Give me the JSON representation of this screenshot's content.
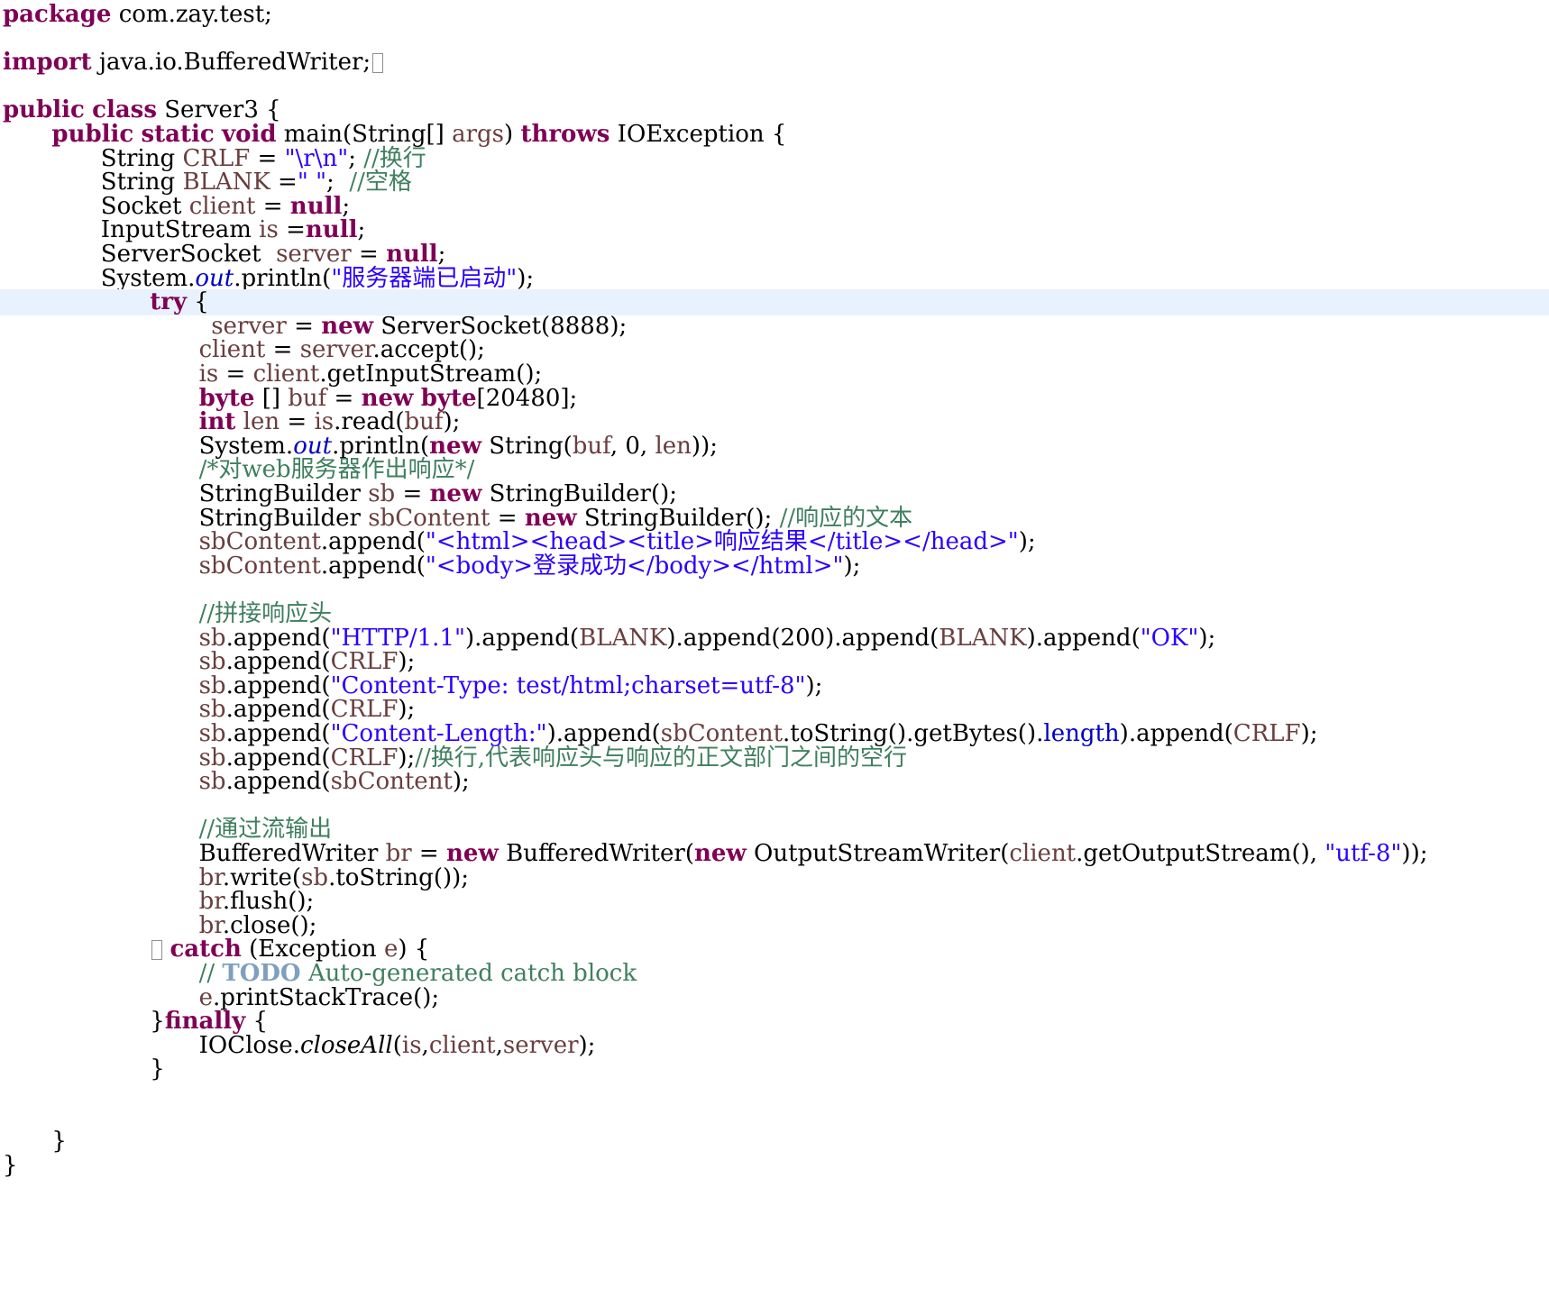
{
  "editor": {
    "current_line_index": 12,
    "lines": [
      {
        "indent": 0,
        "tokens": [
          {
            "t": "kw",
            "v": "package"
          },
          {
            "t": "plain",
            "v": " com.zay.test;"
          }
        ]
      },
      {
        "indent": 0,
        "tokens": []
      },
      {
        "indent": 0,
        "tokens": [
          {
            "t": "kw",
            "v": "import"
          },
          {
            "t": "plain",
            "v": " java.io.BufferedWriter;"
          },
          {
            "t": "fold",
            "v": ""
          }
        ]
      },
      {
        "indent": 0,
        "tokens": []
      },
      {
        "indent": 0,
        "tokens": [
          {
            "t": "kw",
            "v": "public"
          },
          {
            "t": "plain",
            "v": " "
          },
          {
            "t": "kw",
            "v": "class"
          },
          {
            "t": "plain",
            "v": " Server3 {"
          }
        ]
      },
      {
        "indent": 4,
        "tokens": [
          {
            "t": "kw",
            "v": "public"
          },
          {
            "t": "plain",
            "v": " "
          },
          {
            "t": "kw",
            "v": "static"
          },
          {
            "t": "plain",
            "v": " "
          },
          {
            "t": "kw",
            "v": "void"
          },
          {
            "t": "plain",
            "v": " main(String[] "
          },
          {
            "t": "var",
            "v": "args"
          },
          {
            "t": "plain",
            "v": ") "
          },
          {
            "t": "kw",
            "v": "throws"
          },
          {
            "t": "plain",
            "v": " IOException {"
          }
        ]
      },
      {
        "indent": 8,
        "tokens": [
          {
            "t": "plain",
            "v": "String "
          },
          {
            "t": "var",
            "v": "CRLF"
          },
          {
            "t": "plain",
            "v": " = "
          },
          {
            "t": "str",
            "v": "\"\\r\\n\""
          },
          {
            "t": "plain",
            "v": "; "
          },
          {
            "t": "com",
            "v": "//换行"
          }
        ]
      },
      {
        "indent": 8,
        "tokens": [
          {
            "t": "plain",
            "v": "String "
          },
          {
            "t": "var",
            "v": "BLANK"
          },
          {
            "t": "plain",
            "v": " ="
          },
          {
            "t": "str",
            "v": "\" \""
          },
          {
            "t": "plain",
            "v": ";  "
          },
          {
            "t": "com",
            "v": "//空格"
          }
        ]
      },
      {
        "indent": 8,
        "tokens": [
          {
            "t": "plain",
            "v": "Socket "
          },
          {
            "t": "var",
            "v": "client"
          },
          {
            "t": "plain",
            "v": " = "
          },
          {
            "t": "kw",
            "v": "null"
          },
          {
            "t": "plain",
            "v": ";"
          }
        ]
      },
      {
        "indent": 8,
        "tokens": [
          {
            "t": "plain",
            "v": "InputStream "
          },
          {
            "t": "var",
            "v": "is"
          },
          {
            "t": "plain",
            "v": " ="
          },
          {
            "t": "kw",
            "v": "null"
          },
          {
            "t": "plain",
            "v": ";"
          }
        ]
      },
      {
        "indent": 8,
        "tokens": [
          {
            "t": "plain",
            "v": "ServerSocket  "
          },
          {
            "t": "var",
            "v": "server"
          },
          {
            "t": "plain",
            "v": " = "
          },
          {
            "t": "kw",
            "v": "null"
          },
          {
            "t": "plain",
            "v": ";"
          }
        ]
      },
      {
        "indent": 8,
        "tokens": [
          {
            "t": "plain",
            "v": "System."
          },
          {
            "t": "sfield",
            "v": "out"
          },
          {
            "t": "plain",
            "v": ".println("
          },
          {
            "t": "str",
            "v": "\"服务器端已启动\""
          },
          {
            "t": "plain",
            "v": ");"
          }
        ]
      },
      {
        "indent": 12,
        "tokens": [
          {
            "t": "kw",
            "v": "try"
          },
          {
            "t": "plain",
            "v": " {"
          }
        ]
      },
      {
        "indent": 17,
        "tokens": [
          {
            "t": "var",
            "v": "server"
          },
          {
            "t": "plain",
            "v": " = "
          },
          {
            "t": "kw",
            "v": "new"
          },
          {
            "t": "plain",
            "v": " ServerSocket(8888);"
          }
        ]
      },
      {
        "indent": 16,
        "tokens": [
          {
            "t": "var",
            "v": "client"
          },
          {
            "t": "plain",
            "v": " = "
          },
          {
            "t": "var",
            "v": "server"
          },
          {
            "t": "plain",
            "v": ".accept();"
          }
        ]
      },
      {
        "indent": 16,
        "tokens": [
          {
            "t": "var",
            "v": "is"
          },
          {
            "t": "plain",
            "v": " = "
          },
          {
            "t": "var",
            "v": "client"
          },
          {
            "t": "plain",
            "v": ".getInputStream();"
          }
        ]
      },
      {
        "indent": 16,
        "tokens": [
          {
            "t": "kw",
            "v": "byte"
          },
          {
            "t": "plain",
            "v": " [] "
          },
          {
            "t": "var",
            "v": "buf"
          },
          {
            "t": "plain",
            "v": " = "
          },
          {
            "t": "kw",
            "v": "new"
          },
          {
            "t": "plain",
            "v": " "
          },
          {
            "t": "kw",
            "v": "byte"
          },
          {
            "t": "plain",
            "v": "[20480];"
          }
        ]
      },
      {
        "indent": 16,
        "tokens": [
          {
            "t": "kw",
            "v": "int"
          },
          {
            "t": "plain",
            "v": " "
          },
          {
            "t": "var",
            "v": "len"
          },
          {
            "t": "plain",
            "v": " = "
          },
          {
            "t": "var",
            "v": "is"
          },
          {
            "t": "plain",
            "v": ".read("
          },
          {
            "t": "var",
            "v": "buf"
          },
          {
            "t": "plain",
            "v": ");"
          }
        ]
      },
      {
        "indent": 16,
        "tokens": [
          {
            "t": "plain",
            "v": "System."
          },
          {
            "t": "sfield",
            "v": "out"
          },
          {
            "t": "plain",
            "v": ".println("
          },
          {
            "t": "kw",
            "v": "new"
          },
          {
            "t": "plain",
            "v": " String("
          },
          {
            "t": "var",
            "v": "buf"
          },
          {
            "t": "plain",
            "v": ", 0, "
          },
          {
            "t": "var",
            "v": "len"
          },
          {
            "t": "plain",
            "v": "));"
          }
        ]
      },
      {
        "indent": 16,
        "tokens": [
          {
            "t": "com",
            "v": "/*对web服务器作出响应*/"
          }
        ]
      },
      {
        "indent": 16,
        "tokens": [
          {
            "t": "plain",
            "v": "StringBuilder "
          },
          {
            "t": "var",
            "v": "sb"
          },
          {
            "t": "plain",
            "v": " = "
          },
          {
            "t": "kw",
            "v": "new"
          },
          {
            "t": "plain",
            "v": " StringBuilder();"
          }
        ]
      },
      {
        "indent": 16,
        "tokens": [
          {
            "t": "plain",
            "v": "StringBuilder "
          },
          {
            "t": "var",
            "v": "sbContent"
          },
          {
            "t": "plain",
            "v": " = "
          },
          {
            "t": "kw",
            "v": "new"
          },
          {
            "t": "plain",
            "v": " StringBuilder(); "
          },
          {
            "t": "com",
            "v": "//响应的文本"
          }
        ]
      },
      {
        "indent": 16,
        "tokens": [
          {
            "t": "var",
            "v": "sbContent"
          },
          {
            "t": "plain",
            "v": ".append("
          },
          {
            "t": "str",
            "v": "\"<html><head><title>响应结果</title></head>\""
          },
          {
            "t": "plain",
            "v": ");"
          }
        ]
      },
      {
        "indent": 16,
        "tokens": [
          {
            "t": "var",
            "v": "sbContent"
          },
          {
            "t": "plain",
            "v": ".append("
          },
          {
            "t": "str",
            "v": "\"<body>登录成功</body></html>\""
          },
          {
            "t": "plain",
            "v": ");"
          }
        ]
      },
      {
        "indent": 0,
        "tokens": []
      },
      {
        "indent": 16,
        "tokens": [
          {
            "t": "com",
            "v": "//拼接响应头"
          }
        ]
      },
      {
        "indent": 16,
        "tokens": [
          {
            "t": "var",
            "v": "sb"
          },
          {
            "t": "plain",
            "v": ".append("
          },
          {
            "t": "str",
            "v": "\"HTTP/1.1\""
          },
          {
            "t": "plain",
            "v": ").append("
          },
          {
            "t": "var",
            "v": "BLANK"
          },
          {
            "t": "plain",
            "v": ").append(200).append("
          },
          {
            "t": "var",
            "v": "BLANK"
          },
          {
            "t": "plain",
            "v": ").append("
          },
          {
            "t": "str",
            "v": "\"OK\""
          },
          {
            "t": "plain",
            "v": ");"
          }
        ]
      },
      {
        "indent": 16,
        "tokens": [
          {
            "t": "var",
            "v": "sb"
          },
          {
            "t": "plain",
            "v": ".append("
          },
          {
            "t": "var",
            "v": "CRLF"
          },
          {
            "t": "plain",
            "v": ");"
          }
        ]
      },
      {
        "indent": 16,
        "tokens": [
          {
            "t": "var",
            "v": "sb"
          },
          {
            "t": "plain",
            "v": ".append("
          },
          {
            "t": "str",
            "v": "\"Content-Type: test/html;charset=utf-8\""
          },
          {
            "t": "plain",
            "v": ");"
          }
        ]
      },
      {
        "indent": 16,
        "tokens": [
          {
            "t": "var",
            "v": "sb"
          },
          {
            "t": "plain",
            "v": ".append("
          },
          {
            "t": "var",
            "v": "CRLF"
          },
          {
            "t": "plain",
            "v": ");"
          }
        ]
      },
      {
        "indent": 16,
        "tokens": [
          {
            "t": "var",
            "v": "sb"
          },
          {
            "t": "plain",
            "v": ".append("
          },
          {
            "t": "str",
            "v": "\"Content-Length:\""
          },
          {
            "t": "plain",
            "v": ").append("
          },
          {
            "t": "var",
            "v": "sbContent"
          },
          {
            "t": "plain",
            "v": ".toString().getBytes()."
          },
          {
            "t": "field",
            "v": "length"
          },
          {
            "t": "plain",
            "v": ").append("
          },
          {
            "t": "var",
            "v": "CRLF"
          },
          {
            "t": "plain",
            "v": ");"
          }
        ]
      },
      {
        "indent": 16,
        "tokens": [
          {
            "t": "var",
            "v": "sb"
          },
          {
            "t": "plain",
            "v": ".append("
          },
          {
            "t": "var",
            "v": "CRLF"
          },
          {
            "t": "plain",
            "v": ");"
          },
          {
            "t": "com",
            "v": "//换行,代表响应头与响应的正文部门之间的空行"
          }
        ]
      },
      {
        "indent": 16,
        "tokens": [
          {
            "t": "var",
            "v": "sb"
          },
          {
            "t": "plain",
            "v": ".append("
          },
          {
            "t": "var",
            "v": "sbContent"
          },
          {
            "t": "plain",
            "v": ");"
          }
        ]
      },
      {
        "indent": 0,
        "tokens": []
      },
      {
        "indent": 16,
        "tokens": [
          {
            "t": "com",
            "v": "//通过流输出"
          }
        ]
      },
      {
        "indent": 16,
        "tokens": [
          {
            "t": "plain",
            "v": "BufferedWriter "
          },
          {
            "t": "var",
            "v": "br"
          },
          {
            "t": "plain",
            "v": " = "
          },
          {
            "t": "kw",
            "v": "new"
          },
          {
            "t": "plain",
            "v": " BufferedWriter("
          },
          {
            "t": "kw",
            "v": "new"
          },
          {
            "t": "plain",
            "v": " OutputStreamWriter("
          },
          {
            "t": "var",
            "v": "client"
          },
          {
            "t": "plain",
            "v": ".getOutputStream(), "
          },
          {
            "t": "str",
            "v": "\"utf-8\""
          },
          {
            "t": "plain",
            "v": "));"
          }
        ]
      },
      {
        "indent": 16,
        "tokens": [
          {
            "t": "var",
            "v": "br"
          },
          {
            "t": "plain",
            "v": ".write("
          },
          {
            "t": "var",
            "v": "sb"
          },
          {
            "t": "plain",
            "v": ".toString());"
          }
        ]
      },
      {
        "indent": 16,
        "tokens": [
          {
            "t": "var",
            "v": "br"
          },
          {
            "t": "plain",
            "v": ".flush();"
          }
        ]
      },
      {
        "indent": 16,
        "tokens": [
          {
            "t": "var",
            "v": "br"
          },
          {
            "t": "plain",
            "v": ".close();"
          }
        ]
      },
      {
        "indent": 12,
        "tokens": [
          {
            "t": "fold",
            "v": ""
          },
          {
            "t": "plain",
            "v": " "
          },
          {
            "t": "kw",
            "v": "catch"
          },
          {
            "t": "plain",
            "v": " (Exception "
          },
          {
            "t": "var",
            "v": "e"
          },
          {
            "t": "plain",
            "v": ") {"
          }
        ]
      },
      {
        "indent": 16,
        "tokens": [
          {
            "t": "com",
            "v": "// "
          },
          {
            "t": "todo",
            "v": "TODO"
          },
          {
            "t": "com",
            "v": " Auto-generated catch block"
          }
        ]
      },
      {
        "indent": 16,
        "tokens": [
          {
            "t": "var",
            "v": "e"
          },
          {
            "t": "plain",
            "v": ".printStackTrace();"
          }
        ]
      },
      {
        "indent": 12,
        "tokens": [
          {
            "t": "plain",
            "v": "}"
          },
          {
            "t": "kw",
            "v": "finally"
          },
          {
            "t": "plain",
            "v": " {"
          }
        ]
      },
      {
        "indent": 16,
        "tokens": [
          {
            "t": "plain",
            "v": "IOClose."
          },
          {
            "t": "smethod",
            "v": "closeAll"
          },
          {
            "t": "plain",
            "v": "("
          },
          {
            "t": "var",
            "v": "is"
          },
          {
            "t": "plain",
            "v": ","
          },
          {
            "t": "var",
            "v": "client"
          },
          {
            "t": "plain",
            "v": ","
          },
          {
            "t": "var",
            "v": "server"
          },
          {
            "t": "plain",
            "v": ");"
          }
        ]
      },
      {
        "indent": 12,
        "tokens": [
          {
            "t": "plain",
            "v": "}"
          }
        ]
      },
      {
        "indent": 0,
        "tokens": []
      },
      {
        "indent": 0,
        "tokens": []
      },
      {
        "indent": 4,
        "tokens": [
          {
            "t": "plain",
            "v": "}"
          }
        ]
      },
      {
        "indent": 0,
        "tokens": [
          {
            "t": "plain",
            "v": "}"
          }
        ]
      }
    ],
    "colors": {
      "keyword": "#7f0055",
      "string": "#2a00ff",
      "comment": "#3f7f5f",
      "local_variable": "#6a3e3e",
      "field": "#0000c0",
      "todo_tag": "#7f9fbf",
      "current_line_highlight": "#e8f2fe",
      "background": "#ffffff"
    }
  }
}
